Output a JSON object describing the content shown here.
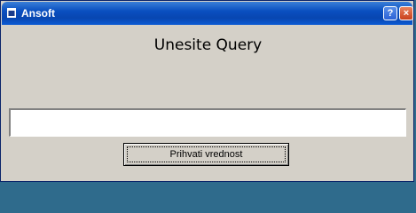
{
  "window": {
    "title": "Ansoft",
    "help_button": "?",
    "close_button": "×"
  },
  "dialog": {
    "heading": "Unesite Query",
    "query_value": "",
    "accept_label": "Prihvati vrednost"
  },
  "colors": {
    "titlebar": "#0a4fc0",
    "face": "#d4d0c8",
    "close": "#c9401c"
  },
  "icons": {
    "app": "app-window-icon",
    "help": "help-icon",
    "close": "close-icon"
  }
}
